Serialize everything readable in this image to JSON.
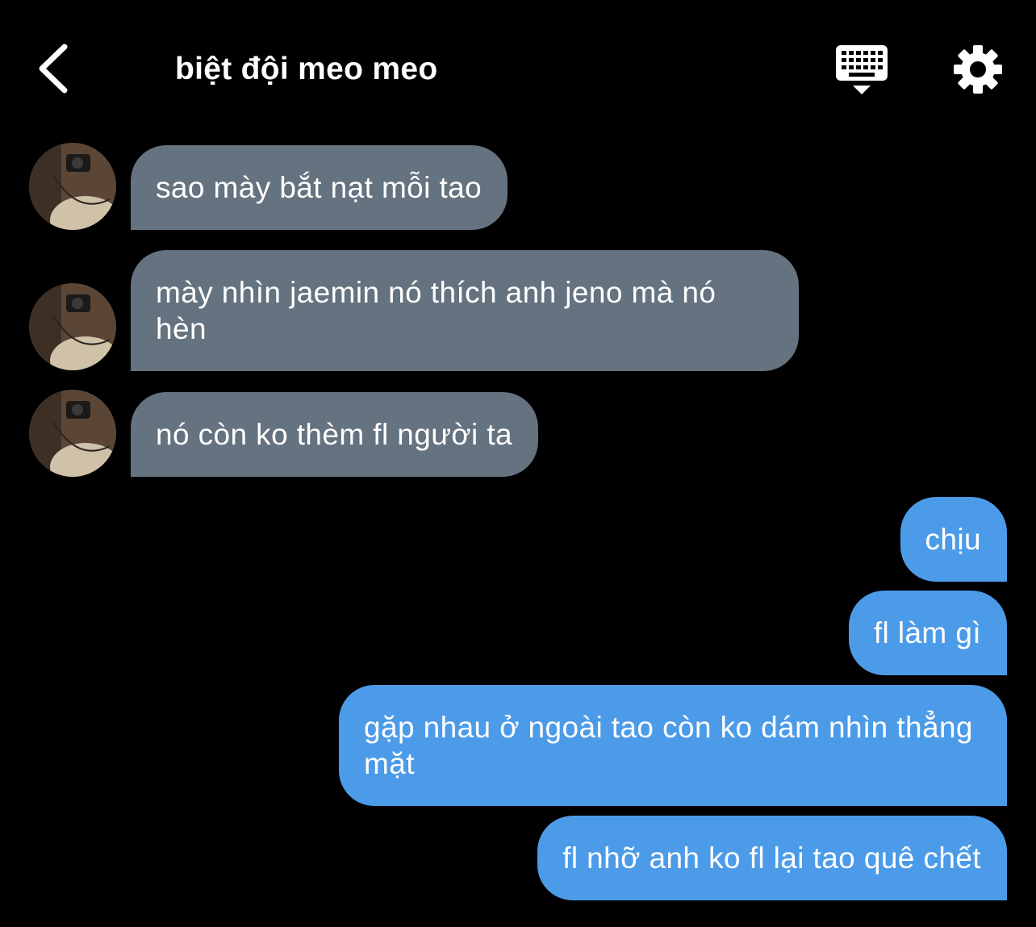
{
  "header": {
    "title": "biệt đội meo meo"
  },
  "messages": [
    {
      "direction": "incoming",
      "text": "sao mày bắt nạt mỗi tao"
    },
    {
      "direction": "incoming",
      "text": "mày nhìn jaemin nó thích anh jeno mà nó hèn"
    },
    {
      "direction": "incoming",
      "text": "nó còn ko thèm fl người ta"
    },
    {
      "direction": "outgoing",
      "text": "chịu"
    },
    {
      "direction": "outgoing",
      "text": "fl làm gì"
    },
    {
      "direction": "outgoing",
      "text": "gặp nhau ở ngoài tao còn ko dám nhìn thẳng mặt"
    },
    {
      "direction": "outgoing",
      "text": "fl nhỡ anh ko fl lại tao quê chết"
    }
  ],
  "colors": {
    "background": "#000000",
    "incoming_bubble": "#65727f",
    "outgoing_bubble": "#4c9be8",
    "text": "#ffffff"
  },
  "icons": {
    "back": "chevron-left-icon",
    "keyboard": "keyboard-hide-icon",
    "settings": "gear-icon",
    "avatar": "avatar"
  }
}
